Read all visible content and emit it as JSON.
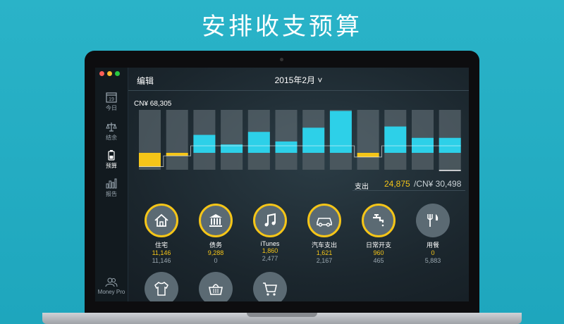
{
  "headline": "安排收支预算",
  "sidebar": {
    "items": [
      {
        "label": "今日",
        "icon": "calendar-icon",
        "day": "19"
      },
      {
        "label": "结余",
        "icon": "scale-icon"
      },
      {
        "label": "预算",
        "icon": "battery-icon"
      },
      {
        "label": "报告",
        "icon": "bar-chart-icon"
      }
    ],
    "footer": "Money Pro"
  },
  "topbar": {
    "edit": "编辑",
    "month": "2015年2月",
    "chevron": "˅"
  },
  "summary": {
    "total": "CN¥ 68,305",
    "spend_label": "支出",
    "spend": "24,875",
    "budget": "/CN¥ 30,498"
  },
  "colors": {
    "accent": "#f5c518",
    "bar": "#2dd0e8",
    "track": "#6b7880"
  },
  "chart_data": {
    "type": "bar",
    "bars": [
      {
        "fill": 0.23,
        "color": "yellow"
      },
      {
        "fill": 0.05,
        "color": "yellow"
      },
      {
        "fill": 0.3,
        "color": "cyan"
      },
      {
        "fill": 0.14,
        "color": "cyan"
      },
      {
        "fill": 0.35,
        "color": "cyan"
      },
      {
        "fill": 0.19,
        "color": "cyan"
      },
      {
        "fill": 0.42,
        "color": "cyan"
      },
      {
        "fill": 0.7,
        "color": "cyan"
      },
      {
        "fill": 0.07,
        "color": "yellow"
      },
      {
        "fill": 0.44,
        "color": "cyan"
      },
      {
        "fill": 0.25,
        "color": "cyan"
      },
      {
        "fill": 0.25,
        "color": "cyan"
      }
    ]
  },
  "categories": [
    {
      "name": "住宅",
      "icon": "house-icon",
      "spent": "11,146",
      "budget": "11,146",
      "full": true
    },
    {
      "name": "债务",
      "icon": "bank-icon",
      "spent": "9,288",
      "budget": "0",
      "full": true
    },
    {
      "name": "iTunes",
      "icon": "music-note-icon",
      "spent": "1,860",
      "budget": "2,477",
      "full": true
    },
    {
      "name": "汽车支出",
      "icon": "car-icon",
      "spent": "1,621",
      "budget": "2,167",
      "full": true
    },
    {
      "name": "日常开支",
      "icon": "faucet-icon",
      "spent": "960",
      "budget": "465",
      "full": true
    },
    {
      "name": "用餐",
      "icon": "utensils-icon",
      "spent": "0",
      "budget": "5,883",
      "full": false
    },
    {
      "icon": "shirt-icon"
    },
    {
      "icon": "basket-icon"
    },
    {
      "icon": "cart-icon"
    }
  ]
}
